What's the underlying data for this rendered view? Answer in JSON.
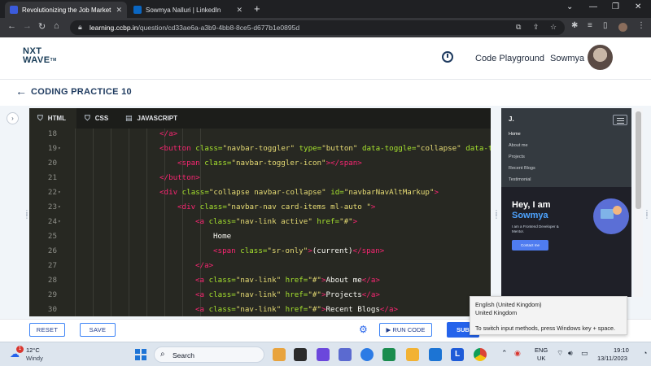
{
  "browser": {
    "tabs": [
      {
        "title": "Revolutionizing the Job Market",
        "favicon_color": "#3b5bdb"
      },
      {
        "title": "Sowmya Nalluri | LinkedIn",
        "favicon_color": "#0a66c2"
      }
    ],
    "address": {
      "host": "learning.ccbp.in",
      "path": "/question/cd33ae6a-a3b9-4bb8-8ce5-d677b1e0895d"
    }
  },
  "header": {
    "logo_line1": "NXT",
    "logo_line2": "WAVE",
    "logo_tm": "TM",
    "playground_label": "Code Playground",
    "user_name": "Sowmya"
  },
  "practice": {
    "title": "CODING PRACTICE 10"
  },
  "editor": {
    "tabs": [
      {
        "label": "HTML",
        "icon": "html5-icon"
      },
      {
        "label": "CSS",
        "icon": "css3-icon"
      },
      {
        "label": "JAVASCRIPT",
        "icon": "file-icon"
      }
    ],
    "lines": [
      {
        "n": "18",
        "fold": false,
        "indent": 5,
        "parts": [
          [
            "t",
            "</a>"
          ]
        ]
      },
      {
        "n": "19",
        "fold": true,
        "indent": 5,
        "parts": [
          [
            "t",
            "<button "
          ],
          [
            "a",
            "class="
          ],
          [
            "s",
            "\"navbar-toggler\""
          ],
          [
            "a",
            " type="
          ],
          [
            "s",
            "\"button\""
          ],
          [
            "a",
            " data-toggle="
          ],
          [
            "s",
            "\"collapse\""
          ],
          [
            "a",
            " data-ta"
          ]
        ]
      },
      {
        "n": "20",
        "fold": false,
        "indent": 6,
        "parts": [
          [
            "t",
            "<span "
          ],
          [
            "a",
            "class="
          ],
          [
            "s",
            "\"navbar-toggler-icon\""
          ],
          [
            "t",
            "></span>"
          ]
        ]
      },
      {
        "n": "21",
        "fold": false,
        "indent": 5,
        "parts": [
          [
            "t",
            "</button>"
          ]
        ]
      },
      {
        "n": "22",
        "fold": true,
        "indent": 5,
        "parts": [
          [
            "t",
            "<div "
          ],
          [
            "a",
            "class="
          ],
          [
            "s",
            "\"collapse navbar-collapse\""
          ],
          [
            "a",
            " id="
          ],
          [
            "s",
            "\"navbarNavAltMarkup\""
          ],
          [
            "t",
            ">"
          ]
        ]
      },
      {
        "n": "23",
        "fold": true,
        "indent": 6,
        "parts": [
          [
            "t",
            "<div "
          ],
          [
            "a",
            "class="
          ],
          [
            "s",
            "\"navbar-nav card-items ml-auto \""
          ],
          [
            "t",
            ">"
          ]
        ]
      },
      {
        "n": "24",
        "fold": true,
        "indent": 7,
        "parts": [
          [
            "t",
            "<a "
          ],
          [
            "a",
            "class="
          ],
          [
            "s",
            "\"nav-link active\""
          ],
          [
            "a",
            " href="
          ],
          [
            "s",
            "\"#\""
          ],
          [
            "t",
            ">"
          ]
        ]
      },
      {
        "n": "25",
        "fold": false,
        "indent": 8,
        "parts": [
          [
            "p",
            "Home"
          ]
        ]
      },
      {
        "n": "26",
        "fold": false,
        "indent": 8,
        "parts": [
          [
            "t",
            "<span "
          ],
          [
            "a",
            "class="
          ],
          [
            "s",
            "\"sr-only\""
          ],
          [
            "t",
            ">"
          ],
          [
            "p",
            "(current)"
          ],
          [
            "t",
            "</span>"
          ]
        ]
      },
      {
        "n": "27",
        "fold": false,
        "indent": 7,
        "parts": [
          [
            "t",
            "</a>"
          ]
        ]
      },
      {
        "n": "28",
        "fold": false,
        "indent": 7,
        "parts": [
          [
            "t",
            "<a "
          ],
          [
            "a",
            "class="
          ],
          [
            "s",
            "\"nav-link\""
          ],
          [
            "a",
            " href="
          ],
          [
            "s",
            "\"#\""
          ],
          [
            "t",
            ">"
          ],
          [
            "p",
            "About me"
          ],
          [
            "t",
            "</a>"
          ]
        ]
      },
      {
        "n": "29",
        "fold": false,
        "indent": 7,
        "parts": [
          [
            "t",
            "<a "
          ],
          [
            "a",
            "class="
          ],
          [
            "s",
            "\"nav-link\""
          ],
          [
            "a",
            " href="
          ],
          [
            "s",
            "\"#\""
          ],
          [
            "t",
            ">"
          ],
          [
            "p",
            "Projects"
          ],
          [
            "t",
            "</a>"
          ]
        ]
      },
      {
        "n": "30",
        "fold": false,
        "indent": 7,
        "parts": [
          [
            "t",
            "<a "
          ],
          [
            "a",
            "class="
          ],
          [
            "s",
            "\"nav-link\""
          ],
          [
            "a",
            " href="
          ],
          [
            "s",
            "\"#\""
          ],
          [
            "t",
            ">"
          ],
          [
            "p",
            "Recent Blogs"
          ],
          [
            "t",
            "</a>"
          ]
        ]
      }
    ]
  },
  "preview": {
    "brand": "J.",
    "nav_items": [
      "Home",
      "About me",
      "Projects",
      "Recent Blogs",
      "Testimonial"
    ],
    "hero_greeting": "Hey, I am",
    "hero_name": "Sowmya",
    "hero_subtitle": "I am a Frontend Developer & Mentor.",
    "contact_button": "Contact me"
  },
  "ime_tooltip": {
    "line1": "English (United Kingdom)",
    "line2": "United Kingdom",
    "line3": "To switch input methods, press Windows key + space."
  },
  "actions": {
    "reset_label": "RESET",
    "save_label": "SAVE",
    "run_label": "RUN CODE",
    "submit_label": "SUB"
  },
  "taskbar": {
    "weather_badge": "1",
    "temperature": "12°C",
    "weather_desc": "Windy",
    "search_placeholder": "Search",
    "lang_code": "ENG",
    "lang_region": "UK",
    "time": "19:10",
    "date": "13/11/2023",
    "app_colors": [
      "#e8a33d",
      "#2b2b2b",
      "#6b47dc",
      "#5b6ad0",
      "#2c7be5",
      "#1a8c4e",
      "#f2b233",
      "#1c74d4",
      "#1e5bd8",
      "#3b3b3b",
      "#db4437"
    ]
  }
}
